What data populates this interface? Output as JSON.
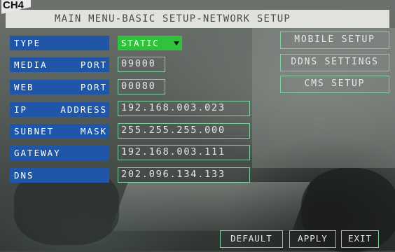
{
  "channel_label": "CH4",
  "title": "MAIN MENU-BASIC SETUP-NETWORK SETUP",
  "rows": [
    {
      "label": [
        "TYPE"
      ],
      "value": "STATIC"
    },
    {
      "label": [
        "MEDIA",
        "PORT"
      ],
      "value": "09000"
    },
    {
      "label": [
        "WEB",
        "PORT"
      ],
      "value": "00080"
    },
    {
      "label": [
        "IP",
        "ADDRESS"
      ],
      "value": "192.168.003.023"
    },
    {
      "label": [
        "SUBNET",
        "MASK"
      ],
      "value": "255.255.255.000"
    },
    {
      "label": [
        "GATEWAY"
      ],
      "value": "192.168.003.111"
    },
    {
      "label": [
        "DNS"
      ],
      "value": "202.096.134.133"
    }
  ],
  "side_buttons": [
    "MOBILE SETUP",
    "DDNS SETTINGS",
    "CMS SETUP"
  ],
  "bottom_buttons": [
    "DEFAULT",
    "APPLY",
    "EXIT"
  ],
  "colors": {
    "label_bg": "#1f56a8",
    "select_bg": "#2fc23a",
    "field_border": "#7fd0a0",
    "title_bg": "#e8e8e4"
  },
  "icons": {
    "type_dropdown": "dropdown-arrow-icon"
  }
}
